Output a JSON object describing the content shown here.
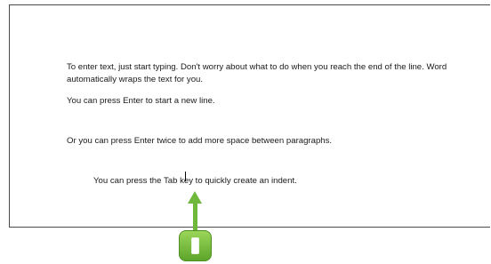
{
  "document": {
    "paragraphs": [
      "To enter text, just start typing. Don't worry about what to do when you reach the end of the line. Word automatically wraps the text for you.",
      "You can press Enter to start a new line.",
      "Or you can press Enter twice to add more space between paragraphs.",
      "You can press the Tab key to quickly create an indent."
    ]
  },
  "callout": {
    "color": "#6fb83c",
    "icon": "step-one-badge-icon"
  }
}
